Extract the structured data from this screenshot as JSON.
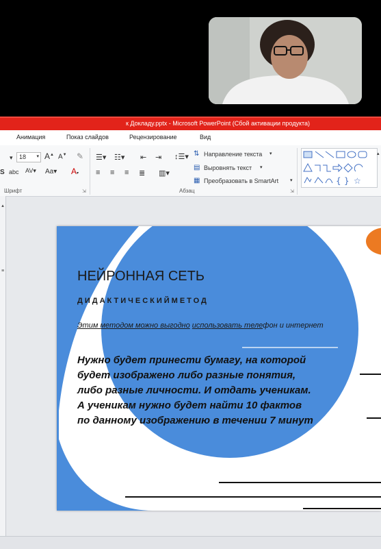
{
  "window": {
    "title": "к Докладу.pptx - Microsoft PowerPoint (Сбой активации продукта)"
  },
  "tabs": [
    "Анимация",
    "Показ слайдов",
    "Рецензирование",
    "Вид"
  ],
  "ribbon": {
    "font_size": "18",
    "font_group_label": "Шрифт",
    "paragraph_group_label": "Абзац",
    "text_direction": "Направление текста",
    "align_text": "Выровнять текст",
    "smartart": "Преобразовать в SmartArt"
  },
  "slide": {
    "title": "НЕЙРОННАЯ СЕТЬ",
    "subtitle": "ДИДАКТИЧЕСКИЙМЕТОД",
    "line_part1": "Этим методом можно выгодно",
    "line_part2": "использовать теле",
    "line_part3": "фон и интернет",
    "body": "Нужно будет принести бумагу, на которой будет изображено либо разные понятия, либо разные личности. И отдать ученикам. А ученикам нужно будет найти 10 фактов по данному изображению в течении 7 минут"
  },
  "colors": {
    "titlebar": "#e2231a",
    "slide_circle": "#4a8cdb",
    "accent_orange": "#ec7a22"
  }
}
